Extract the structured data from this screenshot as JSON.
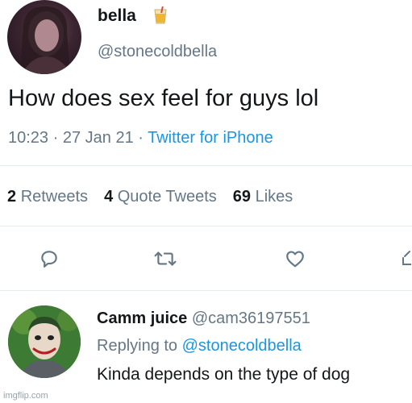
{
  "tweet": {
    "author": {
      "name": "bella",
      "handle": "@stonecoldbella",
      "name_emoji_icon": "juice-glass-icon"
    },
    "text": "How does sex feel for guys lol",
    "meta": {
      "time": "10:23",
      "separator": " · ",
      "date": "27 Jan 21",
      "source": "Twitter for iPhone"
    },
    "stats": {
      "retweets_count": "2",
      "retweets_label": "Retweets",
      "quote_count": "4",
      "quote_label": "Quote Tweets",
      "likes_count": "69",
      "likes_label": "Likes"
    },
    "actions": [
      "reply-icon",
      "retweet-icon",
      "like-icon",
      "share-icon"
    ]
  },
  "reply": {
    "author": {
      "name": "Camm juice",
      "handle": "@cam36197551"
    },
    "replying_prefix": "Replying to ",
    "replying_to": "@stonecoldbella",
    "text": "Kinda depends on the type of dog"
  },
  "watermark": "imgflip.com",
  "colors": {
    "text_primary": "#14171a",
    "text_secondary": "#657786",
    "link": "#1b95e0",
    "divider": "#e6ecf0"
  }
}
